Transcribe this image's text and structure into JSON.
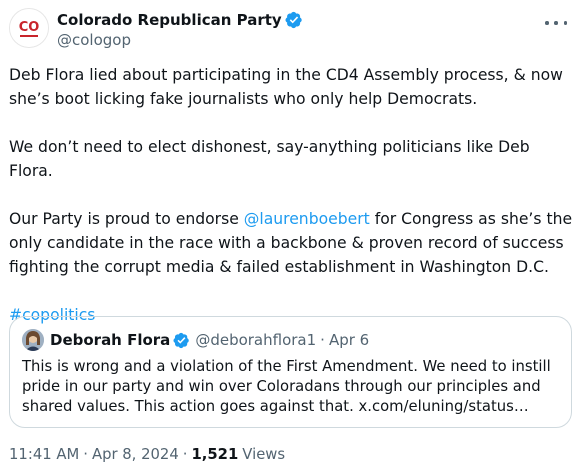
{
  "tweet": {
    "author_name": "Colorado Republican Party",
    "author_handle": "@cologop",
    "avatar_text": "CO",
    "paragraphs": {
      "p1": "Deb Flora lied about participating in the CD4 Assembly process, & now she’s boot licking fake journalists who only help Democrats.",
      "p2": "We don’t need to elect dishonest, say-anything politicians like Deb Flora.",
      "p3_before": "Our Party is proud to endorse ",
      "p3_mention": "@laurenboebert",
      "p3_after": " for Congress as she’s the only candidate in the race with a backbone & proven record of success fighting the corrupt media & failed establishment in Washington D.C.",
      "hashtag": "#copolitics"
    },
    "time": "11:41 AM",
    "date": "Apr 8, 2024",
    "views_count": "1,521",
    "views_label": "Views"
  },
  "quote": {
    "author_name": "Deborah Flora",
    "author_handle": "@deborahflora1",
    "date": "Apr 6",
    "text": "This is wrong and a violation of the First Amendment. We need to instill pride in our party and win over Coloradans through our principles and shared values. This action goes against that. x.com/eluning/status…"
  },
  "colors": {
    "link": "#1d9bf0",
    "verified": "#1d9bf0",
    "text": "#0f1419",
    "secondary": "#536471",
    "border": "#cfd9de",
    "avatar_red": "#c8242b"
  },
  "icons": [
    "verified-badge-icon",
    "more-options-icon"
  ]
}
